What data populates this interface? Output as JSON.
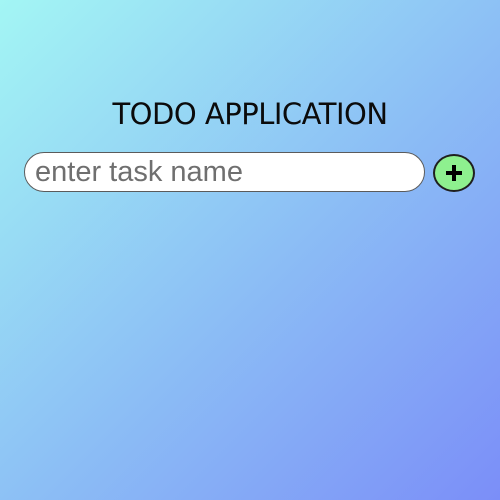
{
  "app": {
    "title": "TODO APPLICATION"
  },
  "task_form": {
    "input_placeholder": "enter task name",
    "input_value": "",
    "add_button_icon": "plus-icon",
    "add_button_color": "#8ef08f"
  },
  "colors": {
    "background_start": "#a3f6f4",
    "background_end": "#7b8ef8"
  }
}
